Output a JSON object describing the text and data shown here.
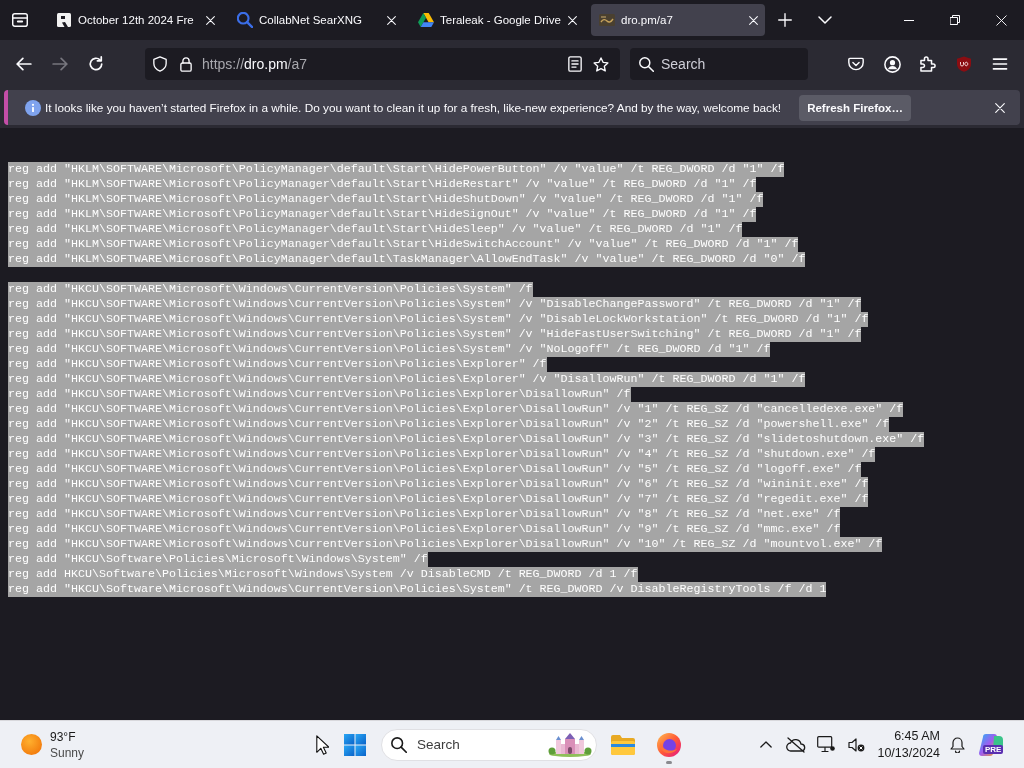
{
  "tab_strip": {
    "tabs": [
      {
        "kind": "letter",
        "title": "October 12th 2024 Fre",
        "selected": false
      },
      {
        "kind": "search",
        "title": "CollabNet SearXNG",
        "selected": false
      },
      {
        "kind": "drive",
        "title": "Teraleak - Google Drive",
        "selected": false
      },
      {
        "kind": "page",
        "title": "dro.pm/a7",
        "selected": true
      }
    ]
  },
  "toolbar": {
    "nav_buttons": [
      {
        "kind": "back",
        "disabled": false
      },
      {
        "kind": "forward",
        "disabled": true
      },
      {
        "kind": "reload",
        "disabled": false
      }
    ],
    "url": {
      "scheme": "https://",
      "host": "dro.pm",
      "path": "/a7"
    },
    "search": {
      "placeholder": "Search"
    }
  },
  "notification": {
    "message": "It looks like you haven’t started Firefox in a while. Do you want to clean it up for a fresh, like-new experience? And by the way, welcome back!",
    "button": "Refresh Firefox…"
  },
  "document": {
    "selected": true,
    "blocks": [
      [
        "reg add \"HKLM\\SOFTWARE\\Microsoft\\PolicyManager\\default\\Start\\HidePowerButton\" /v \"value\" /t REG_DWORD /d \"1\" /f",
        "reg add \"HKLM\\SOFTWARE\\Microsoft\\PolicyManager\\default\\Start\\HideRestart\" /v \"value\" /t REG_DWORD /d \"1\" /f",
        "reg add \"HKLM\\SOFTWARE\\Microsoft\\PolicyManager\\default\\Start\\HideShutDown\" /v \"value\" /t REG_DWORD /d \"1\" /f",
        "reg add \"HKLM\\SOFTWARE\\Microsoft\\PolicyManager\\default\\Start\\HideSignOut\" /v \"value\" /t REG_DWORD /d \"1\" /f",
        "reg add \"HKLM\\SOFTWARE\\Microsoft\\PolicyManager\\default\\Start\\HideSleep\" /v \"value\" /t REG_DWORD /d \"1\" /f",
        "reg add \"HKLM\\SOFTWARE\\Microsoft\\PolicyManager\\default\\Start\\HideSwitchAccount\" /v \"value\" /t REG_DWORD /d \"1\" /f",
        "reg add \"HKLM\\SOFTWARE\\Microsoft\\PolicyManager\\default\\TaskManager\\AllowEndTask\" /v \"value\" /t REG_DWORD /d \"0\" /f"
      ],
      [
        "reg add \"HKCU\\SOFTWARE\\Microsoft\\Windows\\CurrentVersion\\Policies\\System\" /f",
        "reg add \"HKCU\\SOFTWARE\\Microsoft\\Windows\\CurrentVersion\\Policies\\System\" /v \"DisableChangePassword\" /t REG_DWORD /d \"1\" /f",
        "reg add \"HKCU\\SOFTWARE\\Microsoft\\Windows\\CurrentVersion\\Policies\\System\" /v \"DisableLockWorkstation\" /t REG_DWORD /d \"1\" /f",
        "reg add \"HKCU\\SOFTWARE\\Microsoft\\Windows\\CurrentVersion\\Policies\\System\" /v \"HideFastUserSwitching\" /t REG_DWORD /d \"1\" /f",
        "reg add \"HKCU\\SOFTWARE\\Microsoft\\Windows\\CurrentVersion\\Policies\\System\" /v \"NoLogoff\" /t REG_DWORD /d \"1\" /f",
        "reg add \"HKCU\\SOFTWARE\\Microsoft\\Windows\\CurrentVersion\\Policies\\Explorer\" /f",
        "reg add \"HKCU\\SOFTWARE\\Microsoft\\Windows\\CurrentVersion\\Policies\\Explorer\" /v \"DisallowRun\" /t REG_DWORD /d \"1\" /f",
        "reg add \"HKCU\\SOFTWARE\\Microsoft\\Windows\\CurrentVersion\\Policies\\Explorer\\DisallowRun\" /f",
        "reg add \"HKCU\\SOFTWARE\\Microsoft\\Windows\\CurrentVersion\\Policies\\Explorer\\DisallowRun\" /v \"1\" /t REG_SZ /d \"cancelledexe.exe\" /f",
        "reg add \"HKCU\\SOFTWARE\\Microsoft\\Windows\\CurrentVersion\\Policies\\Explorer\\DisallowRun\" /v \"2\" /t REG_SZ /d \"powershell.exe\" /f",
        "reg add \"HKCU\\SOFTWARE\\Microsoft\\Windows\\CurrentVersion\\Policies\\Explorer\\DisallowRun\" /v \"3\" /t REG_SZ /d \"slidetoshutdown.exe\" /f",
        "reg add \"HKCU\\SOFTWARE\\Microsoft\\Windows\\CurrentVersion\\Policies\\Explorer\\DisallowRun\" /v \"4\" /t REG_SZ /d \"shutdown.exe\" /f",
        "reg add \"HKCU\\SOFTWARE\\Microsoft\\Windows\\CurrentVersion\\Policies\\Explorer\\DisallowRun\" /v \"5\" /t REG_SZ /d \"logoff.exe\" /f",
        "reg add \"HKCU\\SOFTWARE\\Microsoft\\Windows\\CurrentVersion\\Policies\\Explorer\\DisallowRun\" /v \"6\" /t REG_SZ /d \"wininit.exe\" /f",
        "reg add \"HKCU\\SOFTWARE\\Microsoft\\Windows\\CurrentVersion\\Policies\\Explorer\\DisallowRun\" /v \"7\" /t REG_SZ /d \"regedit.exe\" /f",
        "reg add \"HKCU\\SOFTWARE\\Microsoft\\Windows\\CurrentVersion\\Policies\\Explorer\\DisallowRun\" /v \"8\" /t REG_SZ /d \"net.exe\" /f",
        "reg add \"HKCU\\SOFTWARE\\Microsoft\\Windows\\CurrentVersion\\Policies\\Explorer\\DisallowRun\" /v \"9\" /t REG_SZ /d \"mmc.exe\" /f",
        "reg add \"HKCU\\SOFTWARE\\Microsoft\\Windows\\CurrentVersion\\Policies\\Explorer\\DisallowRun\" /v \"10\" /t REG_SZ /d \"mountvol.exe\" /f",
        "reg add \"HKCU\\Software\\Policies\\Microsoft\\Windows\\System\" /f",
        "reg add HKCU\\Software\\Policies\\Microsoft\\Windows\\System /v DisableCMD /t REG_DWORD /d 1 /f",
        "reg add \"HKCU\\Software\\Microsoft\\Windows\\CurrentVersion\\Policies\\System\" /t REG_DWORD /v DisableRegistryTools /f /d 1"
      ]
    ]
  },
  "taskbar": {
    "weather": {
      "temperature": "93°F",
      "condition": "Sunny"
    },
    "search": {
      "placeholder": "Search"
    },
    "apps": [
      {
        "kind": "explorer",
        "running": false
      },
      {
        "kind": "browser",
        "running": true
      }
    ],
    "clock": {
      "time": "6:45 AM",
      "date": "10/13/2024"
    },
    "preview_badge": "PRE"
  }
}
